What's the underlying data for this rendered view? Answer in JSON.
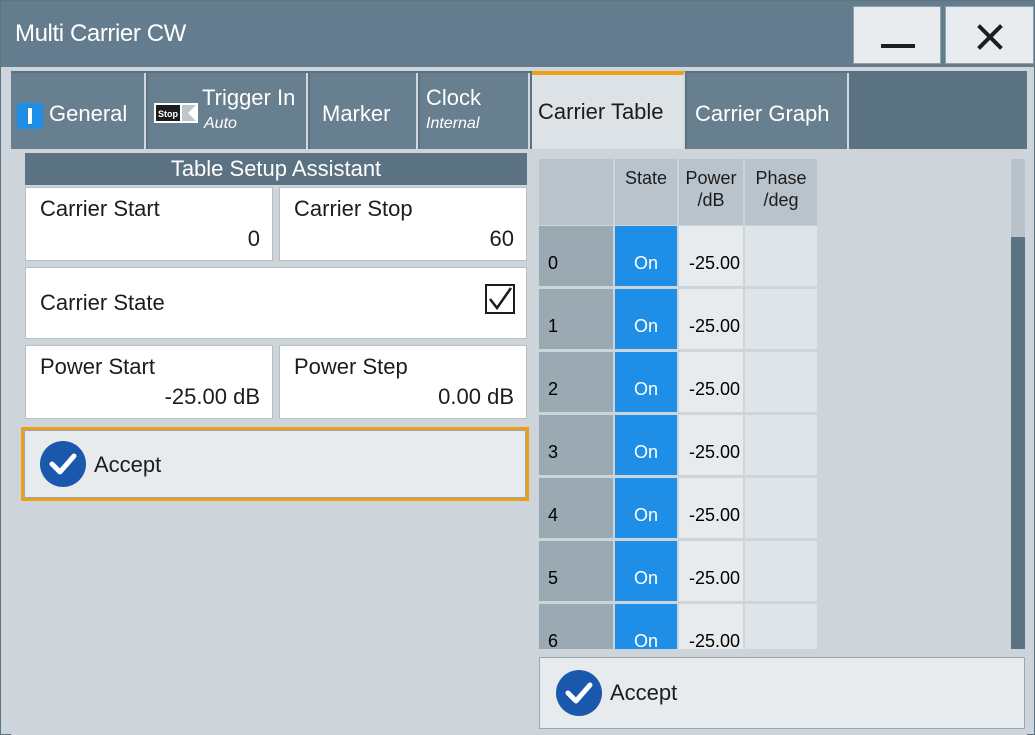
{
  "window": {
    "title": "Multi Carrier CW",
    "min_icon": "minimize-icon",
    "close_icon": "close-icon"
  },
  "tabs": [
    {
      "label": "General",
      "sub": "",
      "icon": "state-indicator-icon",
      "active": false
    },
    {
      "label": "Trigger In",
      "sub": "Auto",
      "icon": "stop-indicator-icon",
      "stop_text": "Stop",
      "active": false
    },
    {
      "label": "Marker",
      "sub": "",
      "active": false
    },
    {
      "label": "Clock",
      "sub": "Internal",
      "active": false
    },
    {
      "label": "Carrier Table",
      "sub": "",
      "active": true
    },
    {
      "label": "Carrier Graph",
      "sub": "",
      "active": false
    }
  ],
  "assistant": {
    "title": "Table Setup Assistant",
    "carrier_start": {
      "label": "Carrier Start",
      "value": "0"
    },
    "carrier_stop": {
      "label": "Carrier Stop",
      "value": "60"
    },
    "carrier_state": {
      "label": "Carrier State",
      "checked": true
    },
    "power_start": {
      "label": "Power Start",
      "value": "-25.00 dB"
    },
    "power_step": {
      "label": "Power Step",
      "value": "0.00 dB"
    },
    "accept_label": "Accept"
  },
  "table": {
    "headers": {
      "state": "State",
      "power_1": "Power",
      "power_2": "/dB",
      "phase_1": "Phase",
      "phase_2": "/deg"
    },
    "rows": [
      {
        "index": "0",
        "state": "On",
        "power": "-25.00",
        "phase": ""
      },
      {
        "index": "1",
        "state": "On",
        "power": "-25.00",
        "phase": ""
      },
      {
        "index": "2",
        "state": "On",
        "power": "-25.00",
        "phase": ""
      },
      {
        "index": "3",
        "state": "On",
        "power": "-25.00",
        "phase": ""
      },
      {
        "index": "4",
        "state": "On",
        "power": "-25.00",
        "phase": ""
      },
      {
        "index": "5",
        "state": "On",
        "power": "-25.00",
        "phase": ""
      },
      {
        "index": "6",
        "state": "On",
        "power": "-25.00",
        "phase": ""
      }
    ],
    "accept_label": "Accept"
  },
  "colors": {
    "accent": "#ee9f19",
    "state_on": "#1e8ee6",
    "accept_icon": "#1a58ad",
    "titlebar": "#647d8e"
  }
}
